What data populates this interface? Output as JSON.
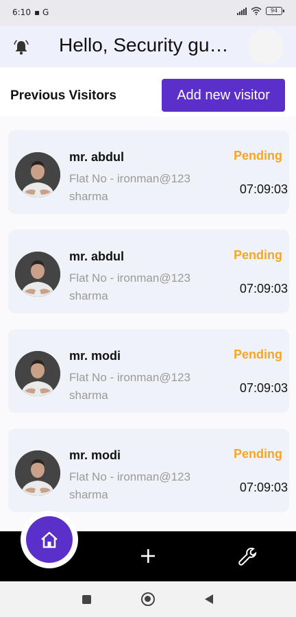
{
  "status_bar": {
    "time": "6:10",
    "left_icons": "▪ G",
    "battery": "94"
  },
  "header": {
    "greeting": "Hello, Security guard"
  },
  "section": {
    "title": "Previous Visitors",
    "add_button_label": "Add new visitor"
  },
  "visitors": [
    {
      "name": "mr. abdul",
      "flat": "Flat No - ironman@123 sharma",
      "status": "Pending",
      "time": "07:09:03"
    },
    {
      "name": "mr. abdul",
      "flat": "Flat No - ironman@123 sharma",
      "status": "Pending",
      "time": "07:09:03"
    },
    {
      "name": "mr. modi",
      "flat": "Flat No - ironman@123 sharma",
      "status": "Pending",
      "time": "07:09:03"
    },
    {
      "name": "mr. modi",
      "flat": "Flat No - ironman@123 sharma",
      "status": "Pending",
      "time": "07:09:03"
    }
  ],
  "bottom_nav": {
    "items": [
      "home-icon",
      "plus-icon",
      "wrench-icon"
    ],
    "active": "home-icon"
  },
  "colors": {
    "accent": "#5b2fc9",
    "pending": "#f5a623",
    "card_bg": "#eff2f9",
    "header_bg": "#eef0fb"
  }
}
